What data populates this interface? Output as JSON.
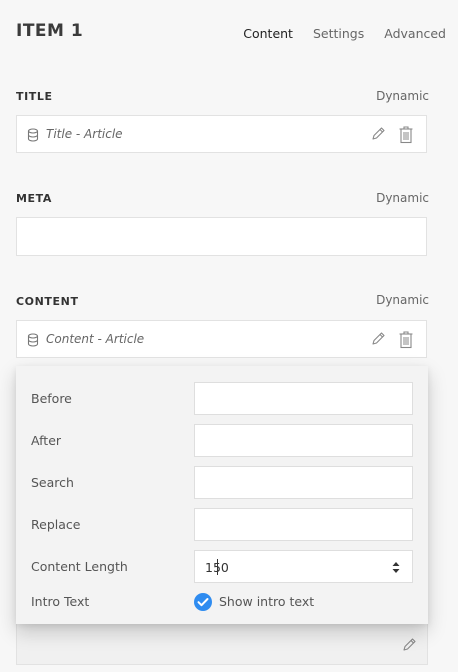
{
  "header": {
    "item_title": "ITEM 1",
    "tabs": [
      {
        "label": "Content",
        "active": true
      },
      {
        "label": "Settings",
        "active": false
      },
      {
        "label": "Advanced",
        "active": false
      }
    ]
  },
  "sections": {
    "title": {
      "label": "TITLE",
      "dynamic_label": "Dynamic",
      "value": "Title - Article"
    },
    "meta": {
      "label": "META",
      "dynamic_label": "Dynamic",
      "value": ""
    },
    "content": {
      "label": "CONTENT",
      "dynamic_label": "Dynamic",
      "value": "Content - Article"
    }
  },
  "content_settings": {
    "before_label": "Before",
    "before_value": "",
    "after_label": "After",
    "after_value": "",
    "search_label": "Search",
    "search_value": "",
    "replace_label": "Replace",
    "replace_value": "",
    "content_length_label": "Content Length",
    "content_length_value": "150",
    "intro_text_label": "Intro Text",
    "intro_text_checkbox_label": "Show intro text",
    "intro_text_checked": true
  },
  "colors": {
    "accent": "#2f8cf0",
    "background": "#f7f7f7",
    "field_border": "#e2e2e2"
  },
  "icons": [
    "database-icon",
    "pencil-icon",
    "trash-icon",
    "check-icon",
    "stepper-icon"
  ]
}
